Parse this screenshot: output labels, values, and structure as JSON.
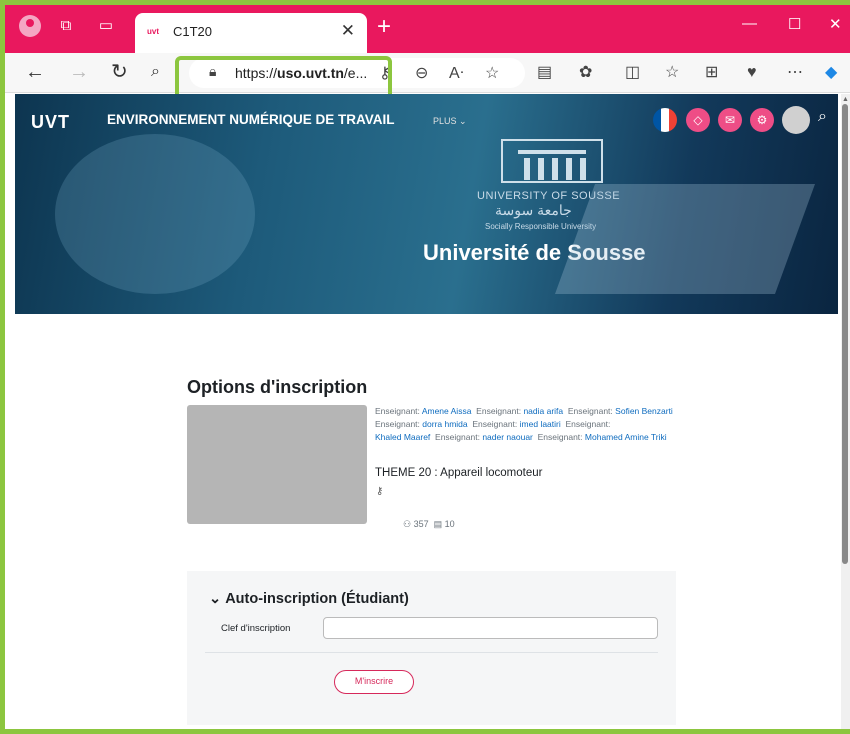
{
  "browser": {
    "tab_title": "C1T20",
    "tab_favicon_text": "uvt",
    "url_prefix": "https://",
    "url_domain": "uso.uvt.tn",
    "url_rest": "/e..."
  },
  "header": {
    "logo_text": "UVT",
    "site_title": "ENVIRONNEMENT NUMÉRIQUE DE TRAVAIL",
    "plus_menu": "PLUS ⌄"
  },
  "hero": {
    "university_en": "UNIVERSITY OF SOUSSE",
    "university_ar": "جامعة سوسة",
    "tagline": "Socially Responsible University",
    "university_name": "Université de Sousse"
  },
  "main": {
    "heading": "Options d'inscription",
    "role_prefix": "Enseignant:",
    "teachers": [
      "Amene Aissa",
      "nadia arifa",
      "Sofien Benzarti",
      "dorra hmida",
      "imed laatiri",
      "Khaled Maaref",
      "nader naouar",
      "Mohamed Amine Triki"
    ],
    "course_title": "THEME 20 : Appareil locomoteur",
    "participants": "357",
    "messages": "10"
  },
  "enrolment": {
    "title": "Auto-inscription (Étudiant)",
    "key_label": "Clef d'inscription",
    "key_value": "",
    "button_label": "M'inscrire"
  },
  "colors": {
    "titlebar": "#e9185e",
    "highlight": "#8cc63f",
    "accent": "#d6295b",
    "link": "#0f6cbf"
  }
}
